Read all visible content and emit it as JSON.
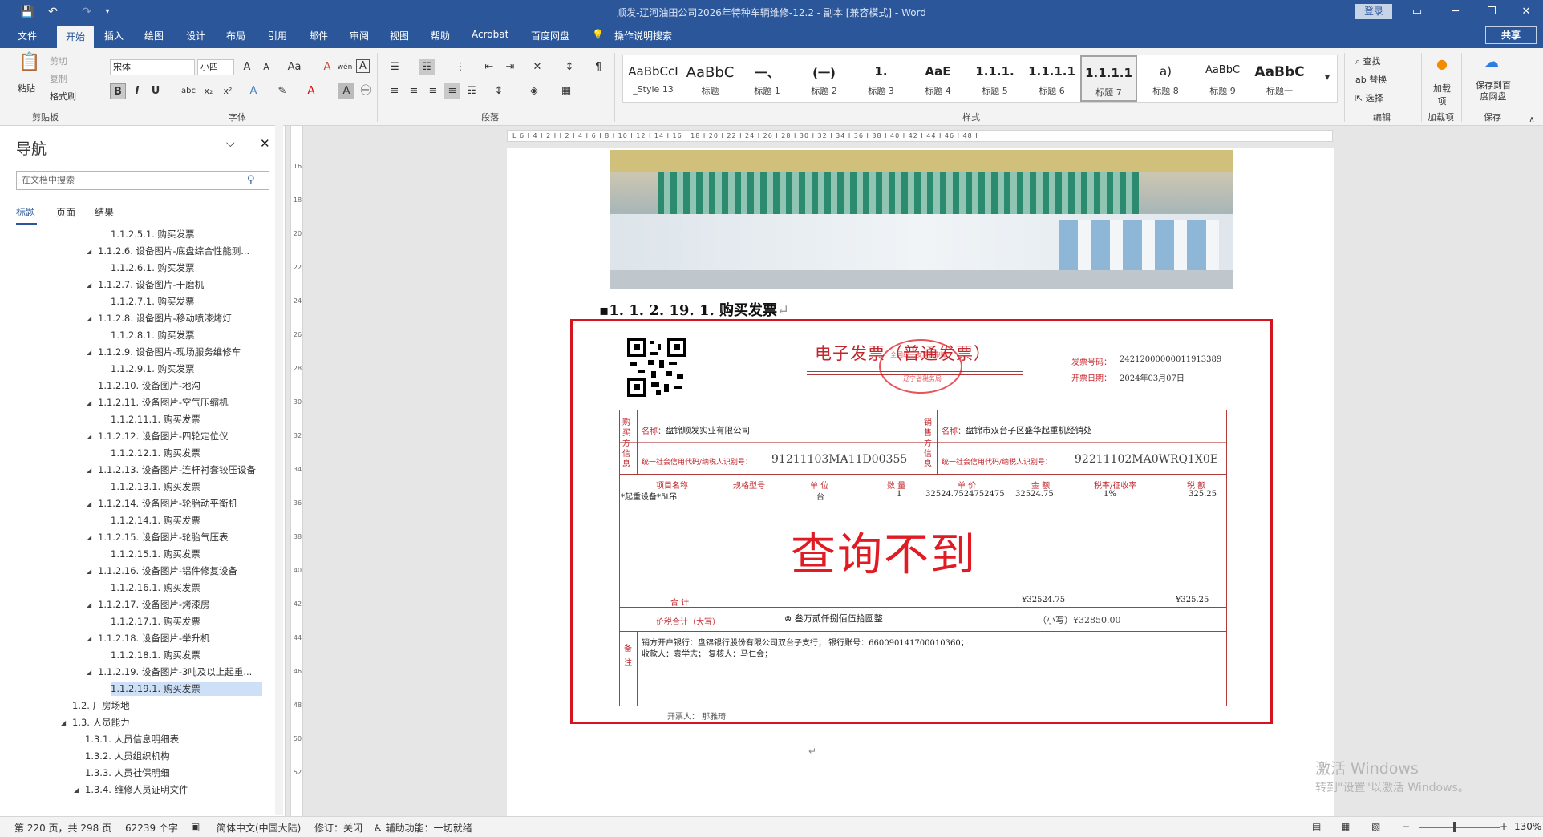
{
  "titlebar": {
    "title": "顺发-辽河油田公司2026年特种车辆维修-12.2 - 副本 [兼容模式] - Word",
    "login": "登录",
    "quick": {
      "save": "💾",
      "undo": "↶",
      "redo": "↷",
      "more": "▾"
    }
  },
  "tabs": [
    "文件",
    "开始",
    "插入",
    "绘图",
    "设计",
    "布局",
    "引用",
    "邮件",
    "审阅",
    "视图",
    "帮助",
    "Acrobat",
    "百度网盘",
    "操作说明搜索"
  ],
  "active_tab": "开始",
  "share": "共享",
  "ribbon": {
    "clipboard": {
      "label": "剪贴板",
      "paste": "粘贴",
      "cut": "剪切",
      "copy": "复制",
      "format_painter": "格式刷"
    },
    "font": {
      "label": "字体",
      "family": "宋体",
      "size": "小四",
      "bold": "B",
      "italic": "I",
      "underline": "U",
      "strike": "abc",
      "sub": "x₂",
      "sup": "x²",
      "grow": "A",
      "shrink": "A",
      "case": "Aa",
      "clear": "A",
      "wen": "wén",
      "charbox": "A"
    },
    "paragraph": {
      "label": "段落"
    },
    "styles": {
      "label": "样式",
      "items": [
        {
          "preview": "AaBbCcI",
          "name": "_Style 13"
        },
        {
          "preview": "AaBbC",
          "name": "标题"
        },
        {
          "preview": "一、",
          "name": "标题 1"
        },
        {
          "preview": "(一)",
          "name": "标题 2"
        },
        {
          "preview": "1.",
          "name": "标题 3"
        },
        {
          "preview": "AaE",
          "name": "标题 4"
        },
        {
          "preview": "1.1.1.",
          "name": "标题 5"
        },
        {
          "preview": "1.1.1.1",
          "name": "标题 6"
        },
        {
          "preview": "1.1.1.1",
          "name": "标题 7"
        },
        {
          "preview": "a)",
          "name": "标题 8"
        },
        {
          "preview": "AaBbC",
          "name": "标题 9"
        },
        {
          "preview": "AaBbC",
          "name": "标题一"
        }
      ]
    },
    "editing": {
      "label": "编辑",
      "find": "查找",
      "replace": "替换",
      "select": "选择"
    },
    "addins": {
      "label": "加载项",
      "btn": "加载项"
    },
    "save": {
      "label": "保存",
      "btn": "保存到百度网盘"
    }
  },
  "nav": {
    "title": "导航",
    "search_placeholder": "在文档中搜索",
    "tabs": [
      "标题",
      "页面",
      "结果"
    ],
    "items": [
      {
        "text": "1.1.2.5.1.   购买发票",
        "level": 3,
        "exp": false,
        "sel": false
      },
      {
        "text": "1.1.2.6. 设备图片-底盘综合性能测...",
        "level": 2,
        "exp": true,
        "sel": false
      },
      {
        "text": "1.1.2.6.1.   购买发票",
        "level": 3,
        "exp": false,
        "sel": false
      },
      {
        "text": "1.1.2.7. 设备图片-干磨机",
        "level": 2,
        "exp": true,
        "sel": false
      },
      {
        "text": "1.1.2.7.1.   购买发票",
        "level": 3,
        "exp": false,
        "sel": false
      },
      {
        "text": "1.1.2.8. 设备图片-移动喷漆烤灯",
        "level": 2,
        "exp": true,
        "sel": false
      },
      {
        "text": "1.1.2.8.1.   购买发票",
        "level": 3,
        "exp": false,
        "sel": false
      },
      {
        "text": "1.1.2.9. 设备图片-现场服务维修车",
        "level": 2,
        "exp": true,
        "sel": false
      },
      {
        "text": "1.1.2.9.1.   购买发票",
        "level": 3,
        "exp": false,
        "sel": false
      },
      {
        "text": "1.1.2.10. 设备图片-地沟",
        "level": 2,
        "exp": false,
        "sel": false
      },
      {
        "text": "1.1.2.11. 设备图片-空气压缩机",
        "level": 2,
        "exp": true,
        "sel": false
      },
      {
        "text": "1.1.2.11.1.   购买发票",
        "level": 3,
        "exp": false,
        "sel": false
      },
      {
        "text": "1.1.2.12. 设备图片-四轮定位仪",
        "level": 2,
        "exp": true,
        "sel": false
      },
      {
        "text": "1.1.2.12.1.   购买发票",
        "level": 3,
        "exp": false,
        "sel": false
      },
      {
        "text": "1.1.2.13. 设备图片-连杆衬套铰压设备",
        "level": 2,
        "exp": true,
        "sel": false
      },
      {
        "text": "1.1.2.13.1.   购买发票",
        "level": 3,
        "exp": false,
        "sel": false
      },
      {
        "text": "1.1.2.14. 设备图片-轮胎动平衡机",
        "level": 2,
        "exp": true,
        "sel": false
      },
      {
        "text": "1.1.2.14.1.   购买发票",
        "level": 3,
        "exp": false,
        "sel": false
      },
      {
        "text": "1.1.2.15. 设备图片-轮胎气压表",
        "level": 2,
        "exp": true,
        "sel": false
      },
      {
        "text": "1.1.2.15.1.   购买发票",
        "level": 3,
        "exp": false,
        "sel": false
      },
      {
        "text": "1.1.2.16. 设备图片-铝件修复设备",
        "level": 2,
        "exp": true,
        "sel": false
      },
      {
        "text": "1.1.2.16.1.   购买发票",
        "level": 3,
        "exp": false,
        "sel": false
      },
      {
        "text": "1.1.2.17. 设备图片-烤漆房",
        "level": 2,
        "exp": true,
        "sel": false
      },
      {
        "text": "1.1.2.17.1.   购买发票",
        "level": 3,
        "exp": false,
        "sel": false
      },
      {
        "text": "1.1.2.18. 设备图片-举升机",
        "level": 2,
        "exp": true,
        "sel": false
      },
      {
        "text": "1.1.2.18.1.   购买发票",
        "level": 3,
        "exp": false,
        "sel": false
      },
      {
        "text": "1.1.2.19. 设备图片-3吨及以上起重...",
        "level": 2,
        "exp": true,
        "sel": false
      },
      {
        "text": "1.1.2.19.1.   购买发票",
        "level": 3,
        "exp": false,
        "sel": true
      },
      {
        "text": "1.2. 厂房场地",
        "level": 0,
        "exp": false,
        "sel": false
      },
      {
        "text": "1.3. 人员能力",
        "level": 0,
        "exp": true,
        "sel": false
      },
      {
        "text": "1.3.1. 人员信息明细表",
        "level": 1,
        "exp": false,
        "sel": false
      },
      {
        "text": "1.3.2. 人员组织机构",
        "level": 1,
        "exp": false,
        "sel": false
      },
      {
        "text": "1.3.3. 人员社保明细",
        "level": 1,
        "exp": false,
        "sel": false
      },
      {
        "text": "1.3.4. 维修人员证明文件",
        "level": 1,
        "exp": true,
        "sel": false
      }
    ]
  },
  "ruler_h": "L 6 I 4 I 2 I   I 2 I 4 I 6 I 8 I 10 I 12 I 14 I 16 I 18 I 20 I 22 I 24 I 26 I 28 I 30 I 32 I 34 I 36 I 38 I 40 I 42 I 44 I 46 I 48 I",
  "ruler_v": [
    "16",
    "18",
    "20",
    "22",
    "24",
    "26",
    "28",
    "30",
    "32",
    "34",
    "36",
    "38",
    "40",
    "42",
    "44",
    "46",
    "48",
    "50",
    "52"
  ],
  "doc": {
    "heading": "1. 1. 2. 19. 1.  购买发票",
    "invoice": {
      "title": "电子发票（普通发票）",
      "seal_text": "全国统一发票监制章",
      "seal_sub": "辽宁省税务局",
      "no_label": "发票号码：",
      "no": "24212000000011913389",
      "date_label": "开票日期：",
      "date": "2024年03月07日",
      "buyer_tag": "购买方信息",
      "buyer_name_label": "名称：",
      "buyer_name": "盘锦顺发实业有限公司",
      "buyer_tax_label": "统一社会信用代码/纳税人识别号：",
      "buyer_tax": "91211103MA11D00355",
      "seller_tag": "销售方信息",
      "seller_name_label": "名称：",
      "seller_name": "盘锦市双台子区盛华起重机经销处",
      "seller_tax_label": "统一社会信用代码/纳税人识别号：",
      "seller_tax": "92211102MA0WRQ1X0E",
      "cols": [
        "项目名称",
        "规格型号",
        "单 位",
        "数 量",
        "单 价",
        "金 额",
        "税率/征收率",
        "税 额"
      ],
      "row": [
        "*起重设备*5t吊",
        "",
        "台",
        "1",
        "32524.7524752475",
        "32524.75",
        "1%",
        "325.25"
      ],
      "stamp": "查询不到",
      "total_label": "合        计",
      "total_amount": "¥32524.75",
      "total_tax": "¥325.25",
      "sum_label": "价税合计（大写）",
      "sum_words": "叁万贰仟捌佰伍拾圆整",
      "sum_small": "（小写）¥32850.00",
      "remark_tag": "备注",
      "remark1": "销方开户银行：盘锦银行股份有限公司双台子支行；     银行账号：660090141700010360；",
      "remark2": "收款人：袁学志；   复核人：马仁会；",
      "issuer": "开票人：  那雅琦"
    }
  },
  "status": {
    "page": "第 220 页，共 298 页",
    "words": "62239 个字",
    "lang": "简体中文(中国大陆)",
    "track": "修订：关闭",
    "access": "辅助功能：一切就绪",
    "zoom": "130%"
  },
  "watermark": {
    "line1": "激活 Windows",
    "line2": "转到\"设置\"以激活 Windows。"
  },
  "colors": {
    "title_bg": "#2b579a",
    "invoice_red": "#c2272d",
    "stamp_red": "#e01b24"
  }
}
